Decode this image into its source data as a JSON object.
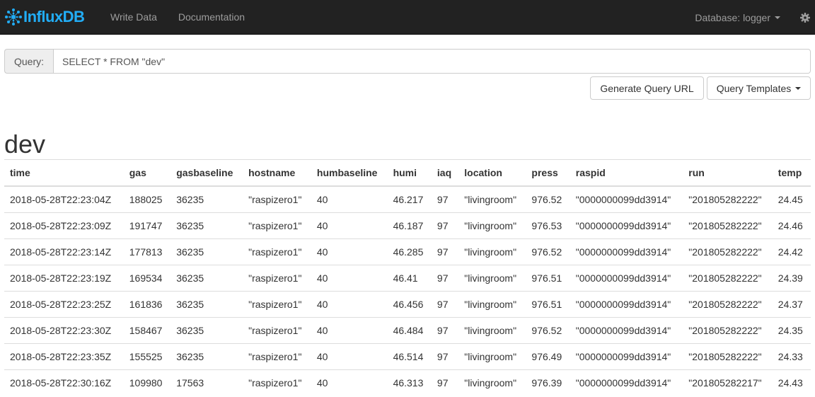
{
  "navbar": {
    "brand": {
      "part1": "Influx",
      "part2": "DB"
    },
    "links": [
      "Write Data",
      "Documentation"
    ],
    "database_label": "Database: logger"
  },
  "query": {
    "label": "Query:",
    "value": "SELECT * FROM \"dev\""
  },
  "buttons": {
    "generate": "Generate Query URL",
    "templates": "Query Templates"
  },
  "series": {
    "name": "dev",
    "columns": [
      "time",
      "gas",
      "gasbaseline",
      "hostname",
      "humbaseline",
      "humi",
      "iaq",
      "location",
      "press",
      "raspid",
      "run",
      "temp"
    ],
    "rows": [
      [
        "2018-05-28T22:23:04Z",
        "188025",
        "36235",
        "\"raspizero1\"",
        "40",
        "46.217",
        "97",
        "\"livingroom\"",
        "976.52",
        "\"0000000099dd3914\"",
        "\"201805282222\"",
        "24.45"
      ],
      [
        "2018-05-28T22:23:09Z",
        "191747",
        "36235",
        "\"raspizero1\"",
        "40",
        "46.187",
        "97",
        "\"livingroom\"",
        "976.53",
        "\"0000000099dd3914\"",
        "\"201805282222\"",
        "24.46"
      ],
      [
        "2018-05-28T22:23:14Z",
        "177813",
        "36235",
        "\"raspizero1\"",
        "40",
        "46.285",
        "97",
        "\"livingroom\"",
        "976.52",
        "\"0000000099dd3914\"",
        "\"201805282222\"",
        "24.42"
      ],
      [
        "2018-05-28T22:23:19Z",
        "169534",
        "36235",
        "\"raspizero1\"",
        "40",
        "46.41",
        "97",
        "\"livingroom\"",
        "976.51",
        "\"0000000099dd3914\"",
        "\"201805282222\"",
        "24.39"
      ],
      [
        "2018-05-28T22:23:25Z",
        "161836",
        "36235",
        "\"raspizero1\"",
        "40",
        "46.456",
        "97",
        "\"livingroom\"",
        "976.51",
        "\"0000000099dd3914\"",
        "\"201805282222\"",
        "24.37"
      ],
      [
        "2018-05-28T22:23:30Z",
        "158467",
        "36235",
        "\"raspizero1\"",
        "40",
        "46.484",
        "97",
        "\"livingroom\"",
        "976.52",
        "\"0000000099dd3914\"",
        "\"201805282222\"",
        "24.35"
      ],
      [
        "2018-05-28T22:23:35Z",
        "155525",
        "36235",
        "\"raspizero1\"",
        "40",
        "46.514",
        "97",
        "\"livingroom\"",
        "976.49",
        "\"0000000099dd3914\"",
        "\"201805282222\"",
        "24.33"
      ],
      [
        "2018-05-28T22:30:16Z",
        "109980",
        "17563",
        "\"raspizero1\"",
        "40",
        "46.313",
        "97",
        "\"livingroom\"",
        "976.39",
        "\"0000000099dd3914\"",
        "\"201805282217\"",
        "24.43"
      ]
    ]
  },
  "colors": {
    "navbar_bg": "#222222",
    "brand": "#22adf6",
    "nav_text": "#9d9d9d"
  },
  "icons": {
    "logo": "influxdb-logo-icon",
    "gear": "gear-icon",
    "caret": "caret-down-icon"
  }
}
